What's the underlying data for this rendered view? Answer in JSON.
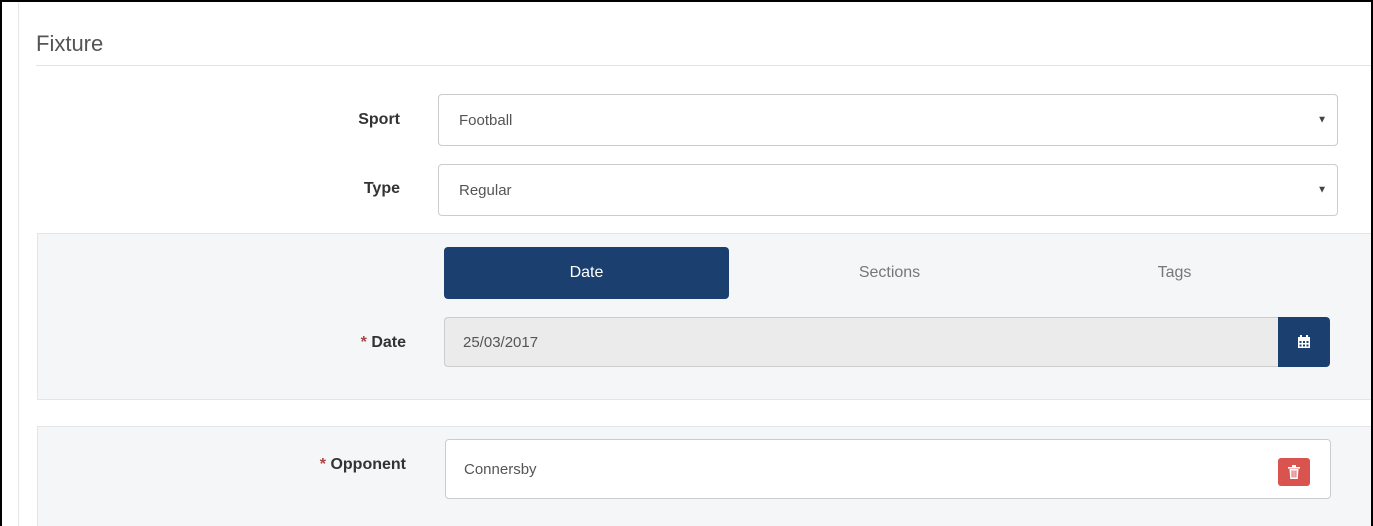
{
  "section": {
    "title": "Fixture"
  },
  "sport": {
    "label": "Sport",
    "value": "Football"
  },
  "type": {
    "label": "Type",
    "value": "Regular"
  },
  "tabs": [
    {
      "label": "Date",
      "active": true
    },
    {
      "label": "Sections",
      "active": false
    },
    {
      "label": "Tags",
      "active": false
    }
  ],
  "date": {
    "required_mark": "*",
    "label": "Date",
    "value": "25/03/2017",
    "button_icon": "calendar-icon"
  },
  "opponent": {
    "required_mark": "*",
    "label": "Opponent",
    "value": "Connersby",
    "remove_icon": "trash-icon"
  },
  "colors": {
    "primary": "#1b3f6e",
    "danger": "#d9534f",
    "required": "#a94442"
  }
}
